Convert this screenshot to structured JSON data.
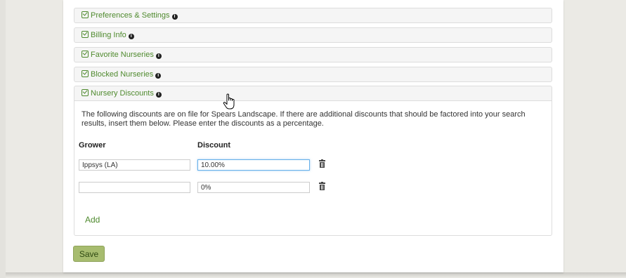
{
  "panels": [
    {
      "label": "Preferences & Settings"
    },
    {
      "label": "Billing Info"
    },
    {
      "label": "Favorite Nurseries"
    },
    {
      "label": "Blocked Nurseries"
    },
    {
      "label": "Nursery Discounts"
    }
  ],
  "discounts": {
    "description": "The following discounts are on file for Spears Landscape. If there are additional discounts that should be factored into your search results, insert them below. Please enter the discounts as a percentage.",
    "grower_header": "Grower",
    "discount_header": "Discount",
    "rows": [
      {
        "grower": "Ippsys (LA)",
        "discount": "10.00%"
      },
      {
        "grower": "",
        "discount": "0%"
      }
    ],
    "add_label": "Add"
  },
  "save_label": "Save",
  "icons": {
    "panel_check": "check-square-icon",
    "panel_info": "info-circle-icon",
    "row_delete": "trash-icon",
    "cursor": "hand-pointer-icon"
  },
  "colors": {
    "accent_green": "#4f8a2e",
    "save_button": "#a7bc6f"
  }
}
